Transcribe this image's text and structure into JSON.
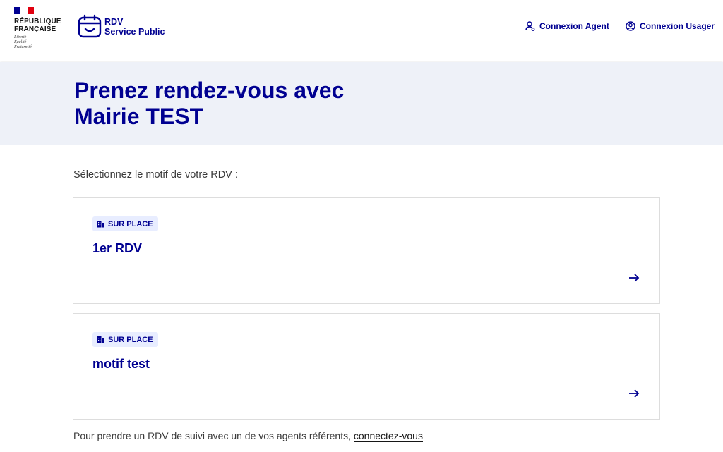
{
  "header": {
    "republic_line1": "RÉPUBLIQUE",
    "republic_line2": "FRANÇAISE",
    "motto": [
      "Liberté",
      "Égalité",
      "Fraternité"
    ],
    "service_line1": "RDV",
    "service_line2": "Service Public",
    "nav": [
      {
        "label": "Connexion Agent",
        "icon": "user-agent-icon"
      },
      {
        "label": "Connexion Usager",
        "icon": "user-circle-icon"
      }
    ]
  },
  "banner": {
    "title_line1": "Prenez rendez-vous avec",
    "title_line2": "Mairie TEST"
  },
  "main": {
    "prompt": "Sélectionnez le motif de votre RDV :",
    "motifs": [
      {
        "badge": "SUR PLACE",
        "badge_icon": "building-icon",
        "title": "1er RDV",
        "action_icon": "arrow-right-icon"
      },
      {
        "badge": "SUR PLACE",
        "badge_icon": "building-icon",
        "title": "motif test",
        "action_icon": "arrow-right-icon"
      }
    ],
    "footer_text": "Pour prendre un RDV de suivi avec un de vos agents référents,",
    "footer_link": "connectez-vous"
  },
  "colors": {
    "primary": "#000091",
    "banner_bg": "#eef1f8",
    "badge_bg": "#e8edff",
    "flag_red": "#e1000f"
  }
}
